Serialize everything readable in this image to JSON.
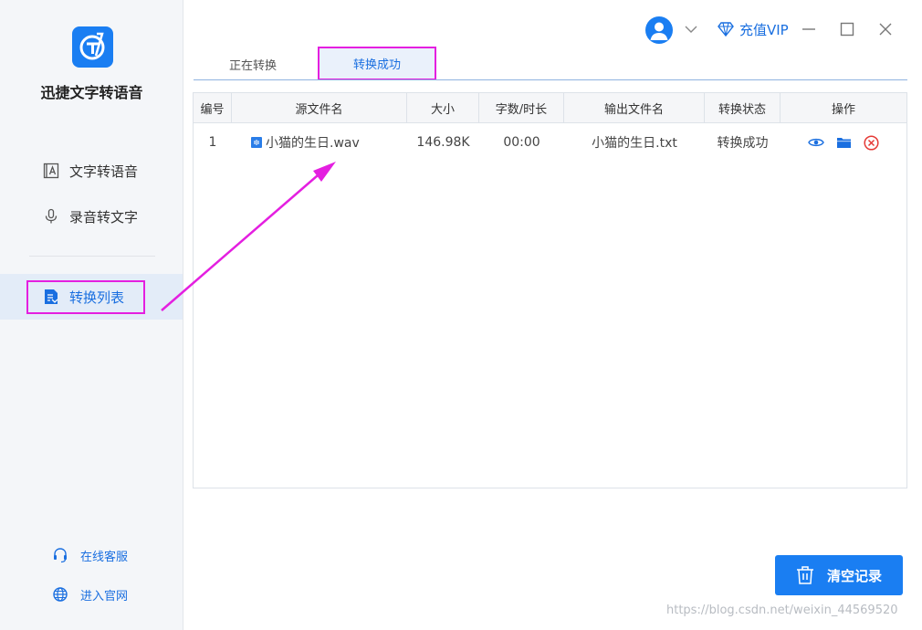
{
  "app": {
    "name": "迅捷文字转语音"
  },
  "sidebar": {
    "items": [
      {
        "label": "文字转语音",
        "icon": "text-book-icon"
      },
      {
        "label": "录音转文字",
        "icon": "microphone-icon"
      },
      {
        "label": "转换列表",
        "icon": "document-list-icon"
      }
    ],
    "footer": [
      {
        "label": "在线客服",
        "icon": "headset-icon"
      },
      {
        "label": "进入官网",
        "icon": "globe-icon"
      }
    ]
  },
  "topbar": {
    "vip_label": "充值VIP"
  },
  "tabs": [
    {
      "label": "正在转换"
    },
    {
      "label": "转换成功"
    }
  ],
  "table": {
    "headers": [
      "编号",
      "源文件名",
      "大小",
      "字数/时长",
      "输出文件名",
      "转换状态",
      "操作"
    ],
    "rows": [
      {
        "index": "1",
        "source": "小猫的生日.wav",
        "size": "146.98K",
        "duration": "00:00",
        "output": "小猫的生日.txt",
        "status": "转换成功"
      }
    ]
  },
  "actions": {
    "clear_label": "清空记录"
  },
  "watermark": "https://blog.csdn.net/weixin_44569520",
  "colors": {
    "accent": "#1a7ef2",
    "annotation": "#e41fe0",
    "delete": "#e53935"
  }
}
